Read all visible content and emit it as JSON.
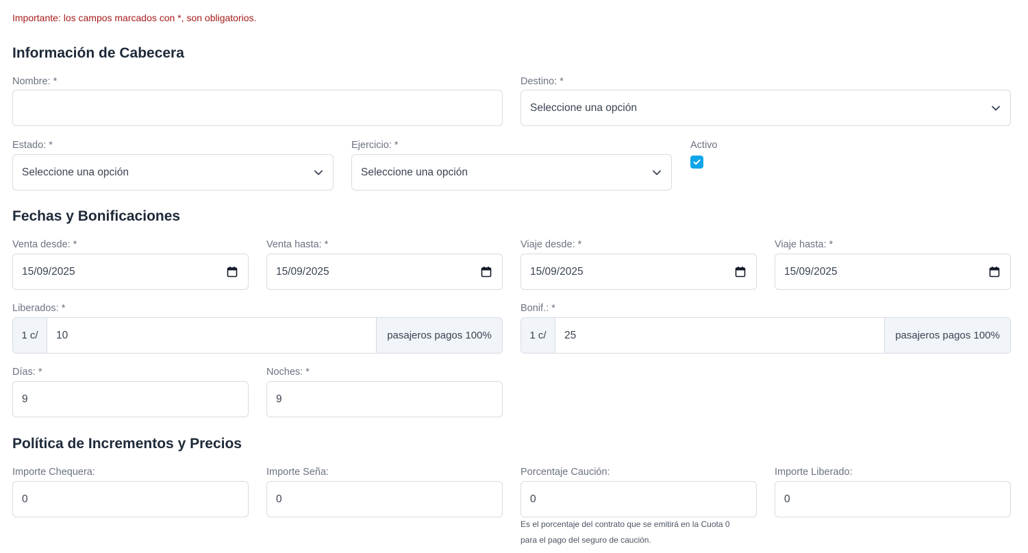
{
  "notice": "Importante: los campos marcados con *, son obligatorios.",
  "header_section": {
    "title": "Información de Cabecera",
    "nombre": {
      "label": "Nombre: *",
      "value": ""
    },
    "destino": {
      "label": "Destino: *",
      "value": "Seleccione una opción"
    },
    "estado": {
      "label": "Estado: *",
      "value": "Seleccione una opción"
    },
    "ejercicio": {
      "label": "Ejercicio: *",
      "value": "Seleccione una opción"
    },
    "activo": {
      "label": "Activo",
      "checked": true
    }
  },
  "dates_section": {
    "title": "Fechas y Bonificaciones",
    "venta_desde": {
      "label": "Venta desde: *",
      "value": "15/09/2025"
    },
    "venta_hasta": {
      "label": "Venta hasta: *",
      "value": "15/09/2025"
    },
    "viaje_desde": {
      "label": "Viaje desde: *",
      "value": "15/09/2025"
    },
    "viaje_hasta": {
      "label": "Viaje hasta: *",
      "value": "15/09/2025"
    },
    "liberados": {
      "label": "Liberados: *",
      "prefix": "1 c/",
      "value": "10",
      "suffix": "pasajeros pagos 100%"
    },
    "bonif": {
      "label": "Bonif.: *",
      "prefix": "1 c/",
      "value": "25",
      "suffix": "pasajeros pagos 100%"
    },
    "dias": {
      "label": "Días: *",
      "value": "9"
    },
    "noches": {
      "label": "Noches: *",
      "value": "9"
    }
  },
  "pricing_section": {
    "title": "Política de Incrementos y Precios",
    "importe_chequera": {
      "label": "Importe Chequera:",
      "value": "0"
    },
    "importe_sena": {
      "label": "Importe Seña:",
      "value": "0"
    },
    "porcentaje_caucion": {
      "label": "Porcentaje Caución:",
      "value": "0",
      "help_line1": "Es el porcentaje del contrato que se emitirá en la Cuota 0",
      "help_line2": "para el pago del seguro de caución."
    },
    "importe_liberado": {
      "label": "Importe Liberado:",
      "value": "0"
    }
  },
  "colors": {
    "notice": "#a61b1b",
    "checkbox": "#0ea5e9",
    "border": "#d6dbe2",
    "addon_bg": "#f1f4f8"
  }
}
